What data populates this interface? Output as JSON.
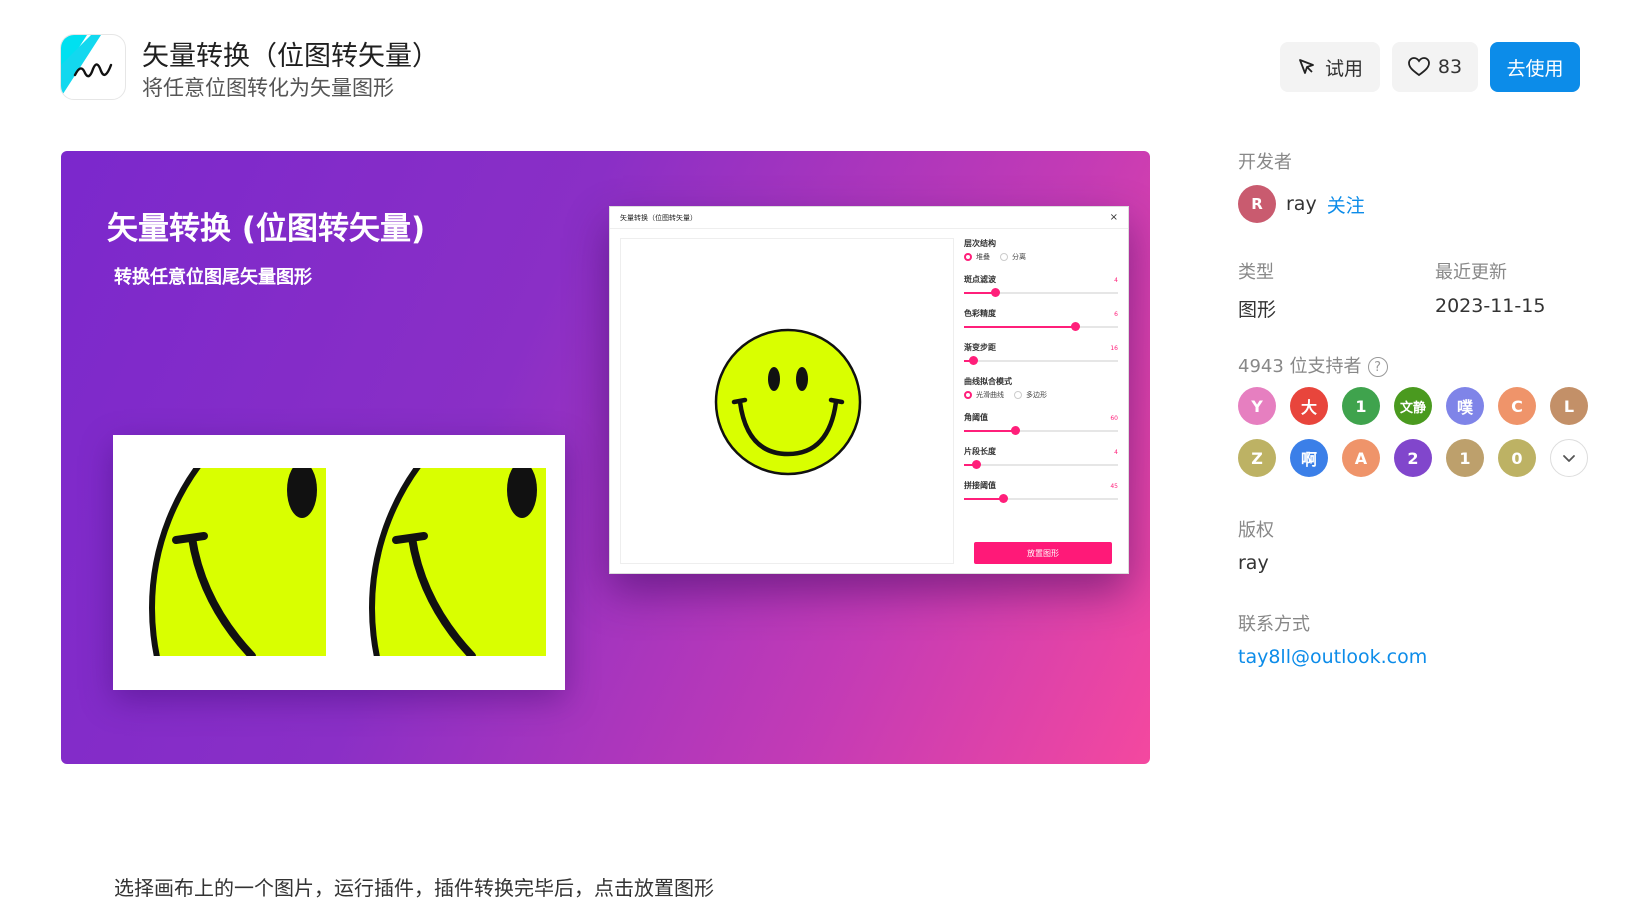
{
  "header": {
    "title": "矢量转换（位图转矢量）",
    "subtitle": "将任意位图转化为矢量图形",
    "try_label": "试用",
    "like_count": "83",
    "use_label": "去使用"
  },
  "banner": {
    "title": "矢量转换 (位图转矢量)",
    "subtitle": "转换任意位图尾矢量图形"
  },
  "plugin_window": {
    "title": "矢量转换（位图转矢量）",
    "close": "×",
    "layer_label": "层次结构",
    "layer_options": [
      "堆叠",
      "分离"
    ],
    "speckle_label": "斑点滤波",
    "speckle_value": "4",
    "speckle_level": 0.2,
    "color_label": "色彩精度",
    "color_value": "6",
    "color_level": 0.72,
    "gradient_label": "渐变步距",
    "gradient_value": "16",
    "gradient_level": 0.06,
    "curve_label": "曲线拟合模式",
    "curve_options": [
      "光滑曲线",
      "多边形"
    ],
    "corner_label": "角阈值",
    "corner_value": "60",
    "corner_level": 0.33,
    "segment_label": "片段长度",
    "segment_value": "4",
    "segment_level": 0.08,
    "splice_label": "拼接阈值",
    "splice_value": "45",
    "splice_level": 0.25,
    "place_button": "放置图形"
  },
  "sidebar": {
    "developer_label": "开发者",
    "developer_initial": "R",
    "developer_name": "ray",
    "follow_label": "关注",
    "type_label": "类型",
    "type_value": "图形",
    "updated_label": "最近更新",
    "updated_value": "2023-11-15",
    "supporters_label": "4943 位支持者",
    "supporters": [
      {
        "text": "Y",
        "color": "#e67fc0"
      },
      {
        "text": "大",
        "color": "#e8453c"
      },
      {
        "text": "1",
        "color": "#3fa34d"
      },
      {
        "text": "文静",
        "color": "#4a9a1f"
      },
      {
        "text": "噗",
        "color": "#7f84e8"
      },
      {
        "text": "C",
        "color": "#ef946a"
      },
      {
        "text": "L",
        "color": "#c39068"
      },
      {
        "text": "Z",
        "color": "#bdb264"
      },
      {
        "text": "啊",
        "color": "#3b7fe8"
      },
      {
        "text": "A",
        "color": "#ef946a"
      },
      {
        "text": "2",
        "color": "#8146cc"
      },
      {
        "text": "1",
        "color": "#bda06c"
      },
      {
        "text": "0",
        "color": "#bdb264"
      }
    ],
    "copyright_label": "版权",
    "copyright_value": "ray",
    "contact_label": "联系方式",
    "contact_value": "tay8ll@outlook.com"
  },
  "description": "选择画布上的一个图片，运行插件，插件转换完毕后，点击放置图形",
  "colors": {
    "accent": "#0c8ce9",
    "plugin_accent": "#ff1978",
    "smiley": "#d9ff00"
  }
}
